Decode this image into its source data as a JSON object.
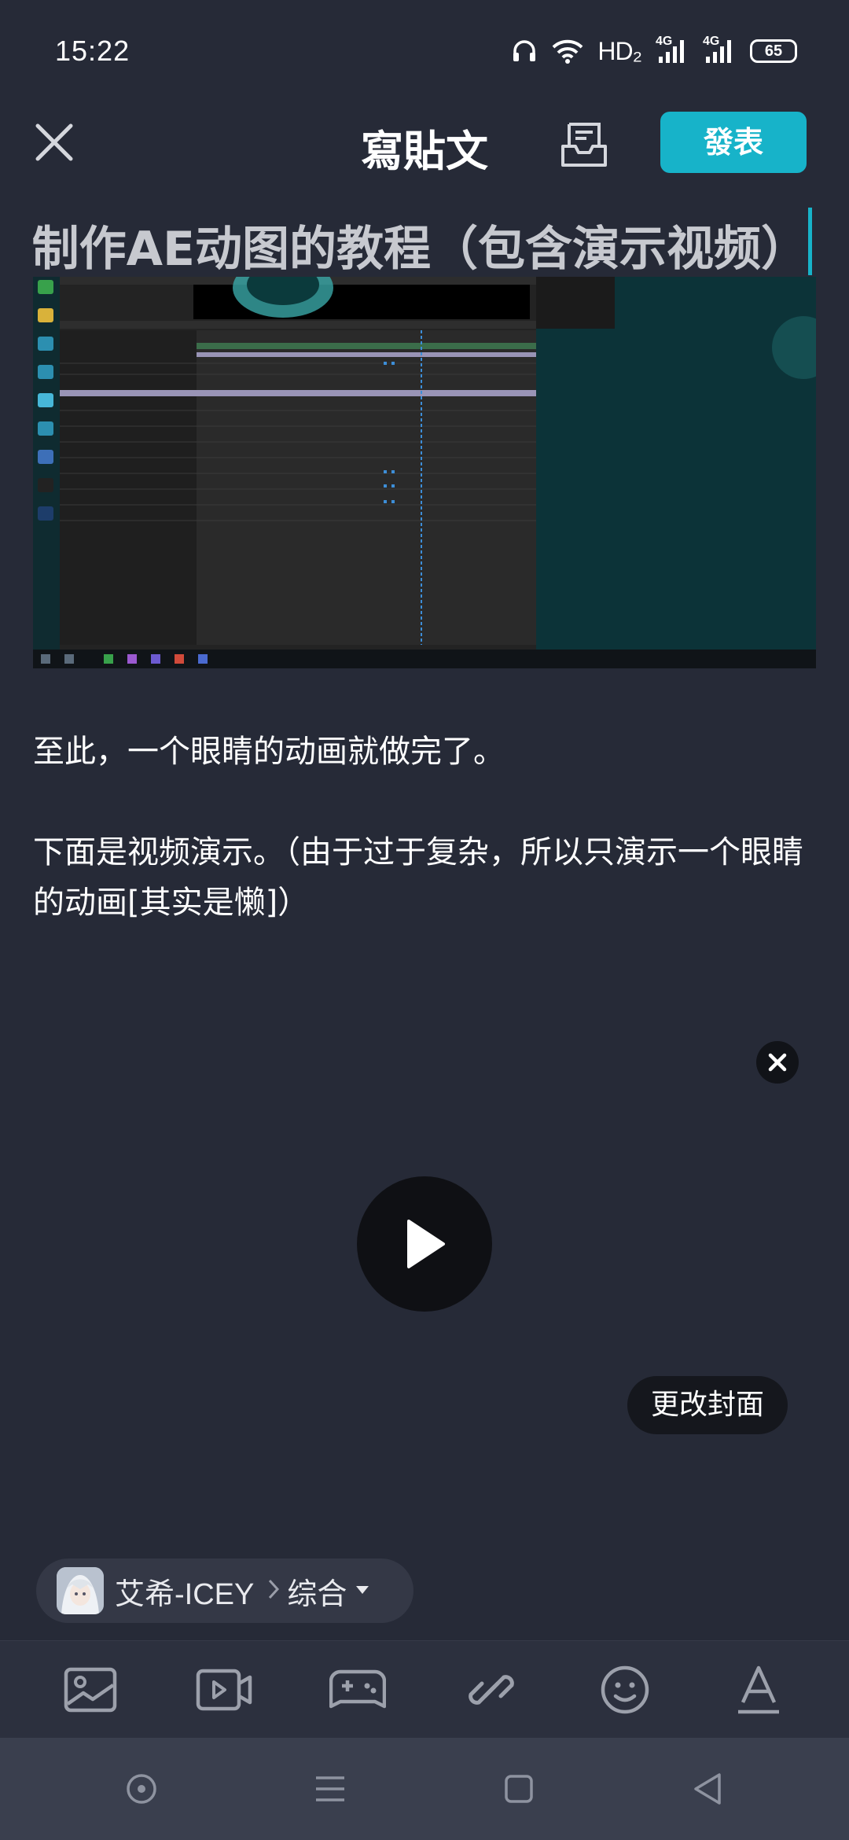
{
  "status_bar": {
    "time": "15:22",
    "network_label": "HD₂",
    "signal_1_label": "4G",
    "signal_2_label": "4G",
    "battery_level": "65"
  },
  "header": {
    "title": "寫貼文",
    "publish_label": "發表"
  },
  "editor": {
    "title_value": "制作AE动图的教程（包含演示视频）",
    "paragraph_1": "至此，一个眼睛的动画就做完了。",
    "paragraph_2": "下面是视频演示。（由于过于复杂，所以只演示一个眼睛的动画[其实是懒]）",
    "change_cover_label": "更改封面"
  },
  "channel": {
    "author": "艾希-ICEY",
    "category": "综合"
  },
  "toolbar": {
    "items": [
      "image-icon",
      "video-icon",
      "gamepad-icon",
      "link-icon",
      "emoji-icon",
      "text-format-icon"
    ]
  },
  "colors": {
    "accent": "#17b3c9",
    "background": "#262a37",
    "toolbar": "#2c303e",
    "navbar": "#3a3f4e"
  }
}
